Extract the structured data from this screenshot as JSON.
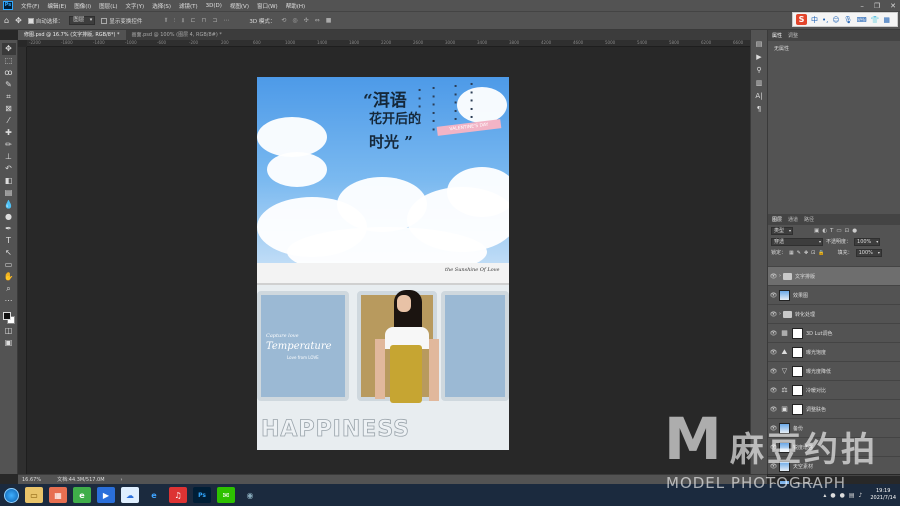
{
  "app": {
    "logo": "Ps"
  },
  "menu": [
    "文件(F)",
    "编辑(E)",
    "图像(I)",
    "图层(L)",
    "文字(Y)",
    "选择(S)",
    "滤镜(T)",
    "3D(D)",
    "视图(V)",
    "窗口(W)",
    "帮助(H)"
  ],
  "options": {
    "auto_select_label": "自动选择：",
    "auto_select_target": "图层",
    "show_transform_label": "显示变换控件",
    "mode_3d": "3D 模式："
  },
  "ime": {
    "lang": "中"
  },
  "tabs": [
    {
      "label": "修图.psd @ 16.7% (文字排版, RGB/8*) *",
      "active": true
    },
    {
      "label": "画面.psd @ 100% (图层 4, RGB/8#) *",
      "active": false
    }
  ],
  "ruler_ticks": [
    "-2200",
    "-1800",
    "-1400",
    "-1000",
    "-600",
    "-200",
    "200",
    "600",
    "1000",
    "1400",
    "1800",
    "2200",
    "2600",
    "3000",
    "3400",
    "3800",
    "4200",
    "4600",
    "5000",
    "5400",
    "5800",
    "6200",
    "6600"
  ],
  "poster": {
    "title_1": "“洱语",
    "title_2": "花开后的",
    "title_3": "时光 ”",
    "ribbon": "VALENTINE'S DAY",
    "script_top": "the Sunshine Of Love",
    "script_small": "Capture love",
    "script_big": "Temperature",
    "script_tiny": "Love from LOVE",
    "happiness": "HAPPINESS"
  },
  "properties": {
    "tabs": [
      "属性",
      "调整"
    ],
    "empty": "无属性"
  },
  "layers": {
    "tabs": [
      "图层",
      "通道",
      "路径"
    ],
    "filter_kind": "类型",
    "blend_mode": "穿透",
    "opacity_label": "不透明度：",
    "opacity": "100%",
    "lock_label": "锁定：",
    "fill_label": "填充：",
    "fill": "100%",
    "items": [
      {
        "name": "文字排版",
        "kind": "folder",
        "selected": true
      },
      {
        "name": "效果图",
        "kind": "image",
        "selected": false
      },
      {
        "name": "转化处理",
        "kind": "folder",
        "selected": false
      },
      {
        "name": "3D Lut调色",
        "kind": "adjust",
        "icon": "▦",
        "selected": false
      },
      {
        "name": "曝光饱度",
        "kind": "adjust",
        "icon": "⛰",
        "selected": false
      },
      {
        "name": "曝光度降低",
        "kind": "adjust",
        "icon": "▽",
        "selected": false
      },
      {
        "name": "冷暖对比",
        "kind": "adjust",
        "icon": "⚖",
        "selected": false
      },
      {
        "name": "调整肤色",
        "kind": "adjust",
        "icon": "▣",
        "selected": false
      },
      {
        "name": "备份",
        "kind": "image",
        "selected": false
      },
      {
        "name": "锐度增强",
        "kind": "image",
        "selected": false
      },
      {
        "name": "天空素材",
        "kind": "image",
        "selected": false
      },
      {
        "name": "智能滤镜",
        "kind": "image",
        "selected": false
      }
    ]
  },
  "status": {
    "zoom": "16.67%",
    "doc": "文档:44.3M/517.0M"
  },
  "taskbar": {
    "time": "19:19",
    "date": "2021/7/14"
  },
  "watermark": {
    "letter": "M",
    "cn": "麻豆约拍",
    "en": "MODEL PHOTOGRAPH"
  }
}
